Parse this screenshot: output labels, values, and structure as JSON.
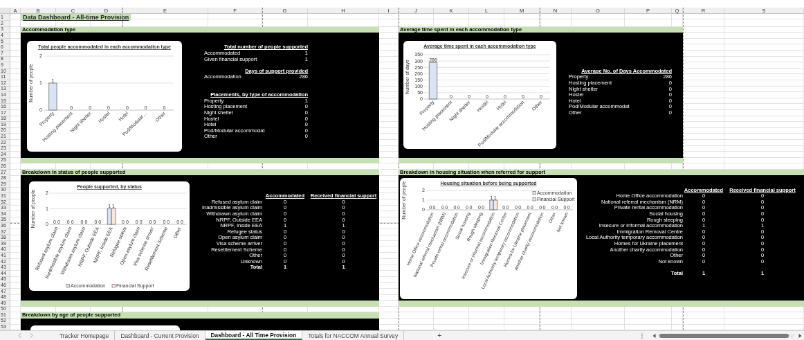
{
  "columns": [
    "A",
    "B",
    "C",
    "D",
    "E",
    "F",
    "G",
    "H",
    "I",
    "J",
    "K",
    "L",
    "M",
    "N",
    "O",
    "P",
    "Q",
    "R",
    "S"
  ],
  "row_numbers": [
    "1",
    "2",
    "3",
    "4",
    "5",
    "6",
    "7",
    "8",
    "9",
    "10",
    "11",
    "12",
    "13",
    "14",
    "15",
    "16",
    "17",
    "18",
    "19",
    "20",
    "21",
    "22",
    "23",
    "24",
    "25",
    "26",
    "27",
    "28",
    "29",
    "30",
    "31",
    "32",
    "33",
    "34",
    "35",
    "36",
    "37",
    "38",
    "39",
    "40",
    "41",
    "42",
    "43",
    "44",
    "45",
    "46",
    "47",
    "48",
    "49",
    "50",
    "51",
    "52",
    "53"
  ],
  "title": "Data Dashboard - All-time Provision",
  "sections": [
    {
      "kind": "summary",
      "heading": "Accommodation type",
      "chart_data": {
        "type": "bar",
        "grid": true,
        "title": "Total people accommodated in each accommodation type",
        "ylabel": "Number of people",
        "categories": [
          "Property",
          "Hosting placement",
          "Night shelter",
          "Hostel",
          "Hotel",
          "Pod/Modular…",
          "Other"
        ],
        "values": [
          1,
          0,
          0,
          0,
          0,
          0,
          0
        ],
        "ylim": [
          0,
          2
        ],
        "yticks": [
          0,
          1,
          2
        ],
        "data_labels": true
      },
      "blocks": [
        {
          "heading": "Total number of people supported",
          "rows": [
            {
              "label": "Accommodated",
              "value": "1"
            },
            {
              "label": "Given financial support",
              "value": "1"
            }
          ]
        },
        {
          "heading": "Days of support provided",
          "rows": [
            {
              "label": "Accommodation",
              "value": "286"
            }
          ]
        },
        {
          "heading": "Placements, by type of accommodation",
          "rows": [
            {
              "label": "Property",
              "value": "1"
            },
            {
              "label": "Hosting placement",
              "value": "0"
            },
            {
              "label": "Night shelter",
              "value": "0"
            },
            {
              "label": "Hostel",
              "value": "0"
            },
            {
              "label": "Hotel",
              "value": "0"
            },
            {
              "label": "Pod/Modular accommodat",
              "value": "0"
            },
            {
              "label": "Other",
              "value": "0"
            }
          ]
        }
      ]
    },
    {
      "kind": "summary",
      "heading": "Average time spent in each accommodation type",
      "chart_data": {
        "type": "bar",
        "grid": true,
        "title": "Average time spent in each accommodation type",
        "ylabel": "Number of days",
        "categories": [
          "Property",
          "Hosting placement",
          "Night shelter",
          "Hostel",
          "Hotel",
          "Pod/Modular accommodation",
          "Other"
        ],
        "values": [
          286,
          0,
          0,
          0,
          0,
          0,
          0
        ],
        "ylim": [
          0,
          350
        ],
        "yticks": [
          0,
          50,
          100,
          150,
          200,
          250,
          300,
          350
        ],
        "data_labels": true
      },
      "blocks": [
        {
          "heading": "Average No. of Days Accommodated",
          "rows": [
            {
              "label": "Property",
              "value": "286"
            },
            {
              "label": "Hosting placement",
              "value": "0"
            },
            {
              "label": "Night shelter",
              "value": "0"
            },
            {
              "label": "Hostel",
              "value": "0"
            },
            {
              "label": "Hotel",
              "value": "0"
            },
            {
              "label": "Pod/Modular accommodat",
              "value": "0"
            },
            {
              "label": "Other",
              "value": "0"
            }
          ]
        }
      ]
    },
    {
      "kind": "matrix",
      "heading": "Breakdown in status of people supported",
      "chart_data": {
        "type": "bar",
        "grid": true,
        "legend": "bottom",
        "title": "People supported, by status",
        "ylabel": "Number of people",
        "categories": [
          "Refused asylum claim",
          "Inadmissible asylum claim",
          "Withdrawn asylum claim",
          "NRPF, Outside EEA",
          "NRPF, Inside EEA",
          "Refugee status",
          "Open asylum claim",
          "Visa scheme arriver",
          "Resettlement Scheme",
          "Other"
        ],
        "series": [
          {
            "name": "Accommodation",
            "color": "#dae3f3",
            "values": [
              0,
              0,
              0,
              0,
              1,
              0,
              0,
              0,
              0,
              0
            ]
          },
          {
            "name": "Financial Support",
            "color": "#fbe5d6",
            "values": [
              0,
              0,
              0,
              0,
              1,
              0,
              0,
              0,
              0,
              0
            ]
          }
        ],
        "ylim": [
          0,
          2
        ],
        "yticks": [
          0,
          1,
          2
        ],
        "data_labels": true
      },
      "columns": [
        "Accommodated",
        "Received financial support"
      ],
      "rows": [
        {
          "label": "Refused asylum claim",
          "values": [
            "0",
            "0"
          ]
        },
        {
          "label": "Inadmissible asylum claim",
          "values": [
            "0",
            "0"
          ]
        },
        {
          "label": "Withdrawn asylum claim",
          "values": [
            "0",
            "0"
          ]
        },
        {
          "label": "NRPF, Outside EEA",
          "values": [
            "0",
            "0"
          ]
        },
        {
          "label": "NRPF, Inside EEA",
          "values": [
            "1",
            "1"
          ]
        },
        {
          "label": "Refugee status",
          "values": [
            "0",
            "0"
          ]
        },
        {
          "label": "Open asylum claim",
          "values": [
            "0",
            "0"
          ]
        },
        {
          "label": "Visa scheme arriver",
          "values": [
            "0",
            "0"
          ]
        },
        {
          "label": "Resettlement Scheme",
          "values": [
            "0",
            "0"
          ]
        },
        {
          "label": "Other",
          "values": [
            "0",
            "0"
          ]
        },
        {
          "label": "Unknown",
          "values": [
            "0",
            "0"
          ]
        }
      ],
      "total": {
        "label": "Total",
        "values": [
          "1",
          "1"
        ]
      }
    },
    {
      "kind": "matrix",
      "heading": "Breakdown in housing situation when referred for support",
      "chart_data": {
        "type": "bar",
        "grid": true,
        "legend": "right",
        "title": "Housing situation before being supported",
        "ylabel": "Number of people",
        "categories": [
          "Home Office accommodation",
          "National referral mechanism (NRM)",
          "Private rental accommodation",
          "Social housing",
          "Rough sleeping",
          "Insecure or informal accommodation",
          "Immigration Removal Centre",
          "Local Authority temporary accommodation",
          "Homes for Ukraine placement",
          "Another charity accommodation",
          "Other",
          "Not known"
        ],
        "series": [
          {
            "name": "Accommodation",
            "color": "#dae3f3",
            "values": [
              0,
              0,
              0,
              0,
              0,
              1,
              0,
              0,
              0,
              0,
              0,
              0
            ]
          },
          {
            "name": "Financial Support",
            "color": "#fbe5d6",
            "values": [
              0,
              0,
              0,
              0,
              0,
              1,
              0,
              0,
              0,
              0,
              0,
              0
            ]
          }
        ],
        "ylim": [
          0,
          2
        ],
        "yticks": [
          0,
          1,
          2
        ],
        "data_labels": true
      },
      "columns": [
        "Accommodated",
        "Received financial support"
      ],
      "rows": [
        {
          "label": "Home Office accommodation",
          "values": [
            "0",
            "0"
          ]
        },
        {
          "label": "National referral mechanism (NRM)",
          "values": [
            "0",
            "0"
          ]
        },
        {
          "label": "Private rental accommodation",
          "values": [
            "0",
            "0"
          ]
        },
        {
          "label": "Social housing",
          "values": [
            "0",
            "0"
          ]
        },
        {
          "label": "Rough sleeping",
          "values": [
            "0",
            "0"
          ]
        },
        {
          "label": "Insecure or informal accommodation",
          "values": [
            "1",
            "1"
          ]
        },
        {
          "label": "Immigration Removal Centre",
          "values": [
            "0",
            "0"
          ]
        },
        {
          "label": "Local Authority temporary accommodation",
          "values": [
            "0",
            "0"
          ]
        },
        {
          "label": "Homes for Ukraine placement",
          "values": [
            "0",
            "0"
          ]
        },
        {
          "label": "Another charity accommodation",
          "values": [
            "0",
            "0"
          ]
        },
        {
          "label": "Other",
          "values": [
            "0",
            "0"
          ]
        },
        {
          "label": "Not known",
          "values": [
            "0",
            "0"
          ]
        }
      ],
      "total": {
        "label": "Total",
        "values": [
          "1",
          "1"
        ]
      }
    },
    {
      "kind": "partial",
      "heading": "Breakdown by age of people supported"
    }
  ],
  "sheet_tabs": [
    {
      "label": "Tracker Homepage",
      "selected": false
    },
    {
      "label": "Dashboard - Current Provision",
      "selected": false
    },
    {
      "label": "Dashboard - All Time Provision",
      "selected": true
    },
    {
      "label": "Totals for NACCOM Annual Survey",
      "selected": false
    }
  ],
  "add_sheet": "+"
}
